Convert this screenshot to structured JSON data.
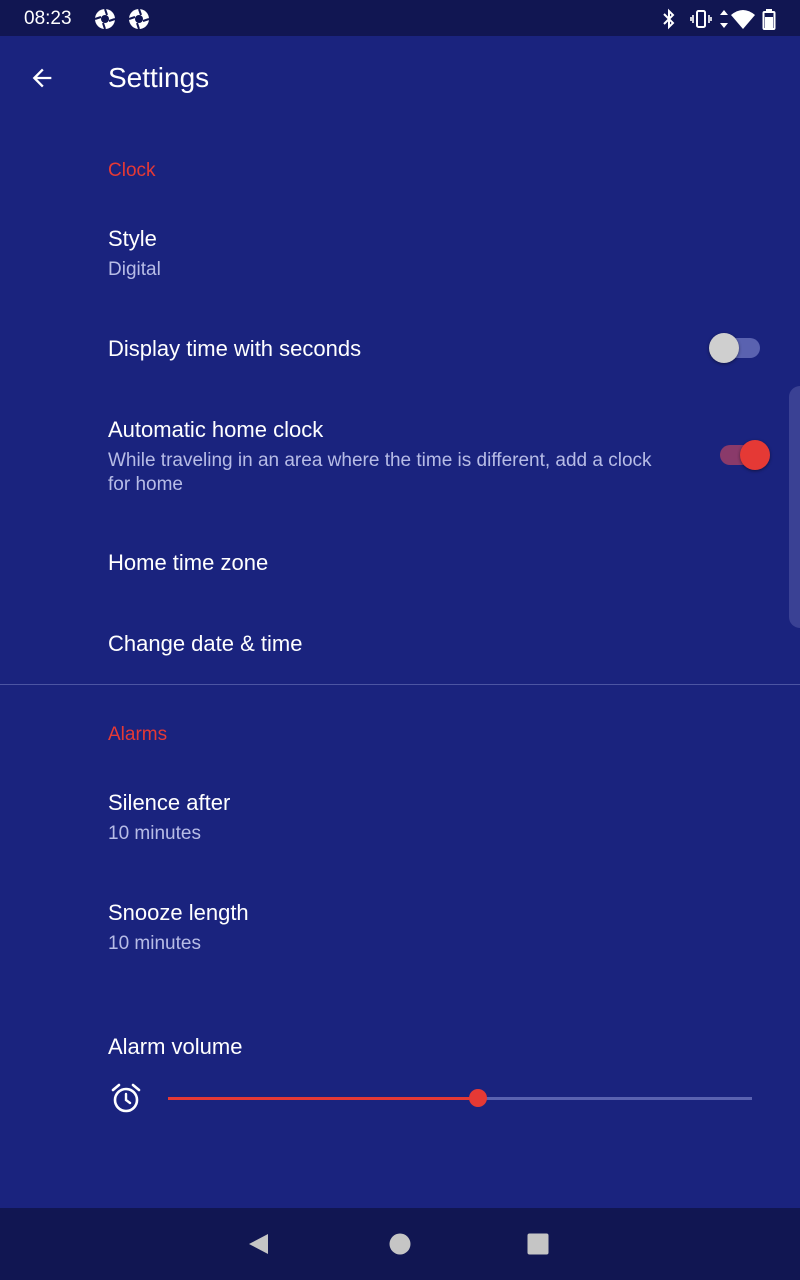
{
  "status_bar": {
    "time": "08:23",
    "icons": [
      "aperture-icon",
      "aperture-icon",
      "bluetooth-icon",
      "vibrate-icon",
      "data-arrows-icon",
      "wifi-icon",
      "battery-icon"
    ]
  },
  "toolbar": {
    "title": "Settings",
    "back_icon": "arrow-back-icon"
  },
  "colors": {
    "background": "#1a237e",
    "accent": "#e53935",
    "secondary_text": "#b7bce6"
  },
  "sections": {
    "clock": {
      "header": "Clock",
      "style": {
        "title": "Style",
        "value": "Digital"
      },
      "seconds": {
        "title": "Display time with seconds",
        "checked": false
      },
      "auto_home": {
        "title": "Automatic home clock",
        "summary": "While traveling in an area where the time is different, add a clock for home",
        "checked": true
      },
      "home_tz": {
        "title": "Home time zone"
      },
      "date_time": {
        "title": "Change date & time"
      }
    },
    "alarms": {
      "header": "Alarms",
      "silence": {
        "title": "Silence after",
        "value": "10 minutes"
      },
      "snooze": {
        "title": "Snooze length",
        "value": "10 minutes"
      },
      "volume": {
        "title": "Alarm volume",
        "level_fraction": 0.53,
        "icon": "alarm-clock-icon"
      }
    }
  },
  "nav_bar": {
    "buttons": [
      "back-triangle-icon",
      "home-circle-icon",
      "recents-square-icon"
    ]
  }
}
